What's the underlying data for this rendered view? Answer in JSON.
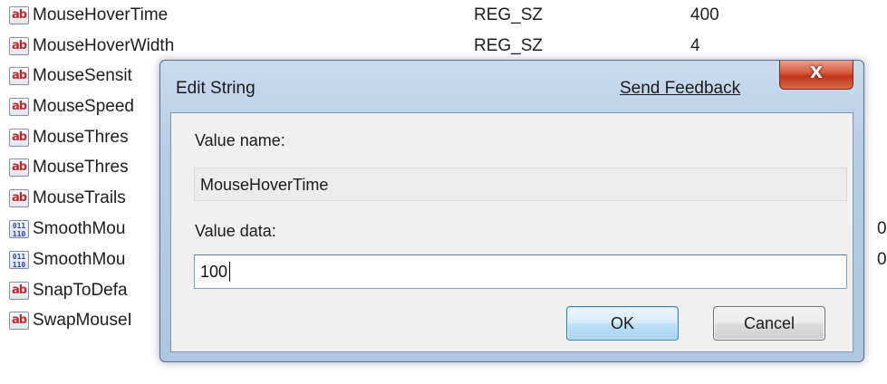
{
  "registry_rows": [
    {
      "icon": "string-value-icon",
      "icon_text": "ab",
      "name": "MouseHoverTime",
      "type": "REG_SZ",
      "data": "400",
      "data_far": ""
    },
    {
      "icon": "string-value-icon",
      "icon_text": "ab",
      "name": "MouseHoverWidth",
      "type": "REG_SZ",
      "data": "4",
      "data_far": ""
    },
    {
      "icon": "string-value-icon",
      "icon_text": "ab",
      "name": "MouseSensit",
      "type": "",
      "data": "",
      "data_far": ""
    },
    {
      "icon": "string-value-icon",
      "icon_text": "ab",
      "name": "MouseSpeed",
      "type": "",
      "data": "",
      "data_far": ""
    },
    {
      "icon": "string-value-icon",
      "icon_text": "ab",
      "name": "MouseThres",
      "type": "",
      "data": "",
      "data_far": ""
    },
    {
      "icon": "string-value-icon",
      "icon_text": "ab",
      "name": "MouseThres",
      "type": "",
      "data": "",
      "data_far": ""
    },
    {
      "icon": "string-value-icon",
      "icon_text": "ab",
      "name": "MouseTrails",
      "type": "",
      "data": "",
      "data_far": ""
    },
    {
      "icon": "binary-value-icon",
      "icon_text": "011\n110",
      "name": "SmoothMou",
      "type": "",
      "data": "",
      "data_far": "0"
    },
    {
      "icon": "binary-value-icon",
      "icon_text": "011\n110",
      "name": "SmoothMou",
      "type": "",
      "data": "",
      "data_far": "0"
    },
    {
      "icon": "string-value-icon",
      "icon_text": "ab",
      "name": "SnapToDefa",
      "type": "",
      "data": "",
      "data_far": ""
    },
    {
      "icon": "string-value-icon",
      "icon_text": "ab",
      "name": "SwapMouseI",
      "type": "",
      "data": "",
      "data_far": ""
    }
  ],
  "dialog": {
    "title": "Edit String",
    "feedback_link": "Send Feedback",
    "close_glyph": "X",
    "value_name_label": "Value name:",
    "value_name": "MouseHoverTime",
    "value_data_label": "Value data:",
    "value_data": "100",
    "ok_label": "OK",
    "cancel_label": "Cancel"
  },
  "colors": {
    "close_button": "#c2331b",
    "ok_button_border": "#3c7fb1",
    "dialog_frame": "#b7cde6"
  }
}
